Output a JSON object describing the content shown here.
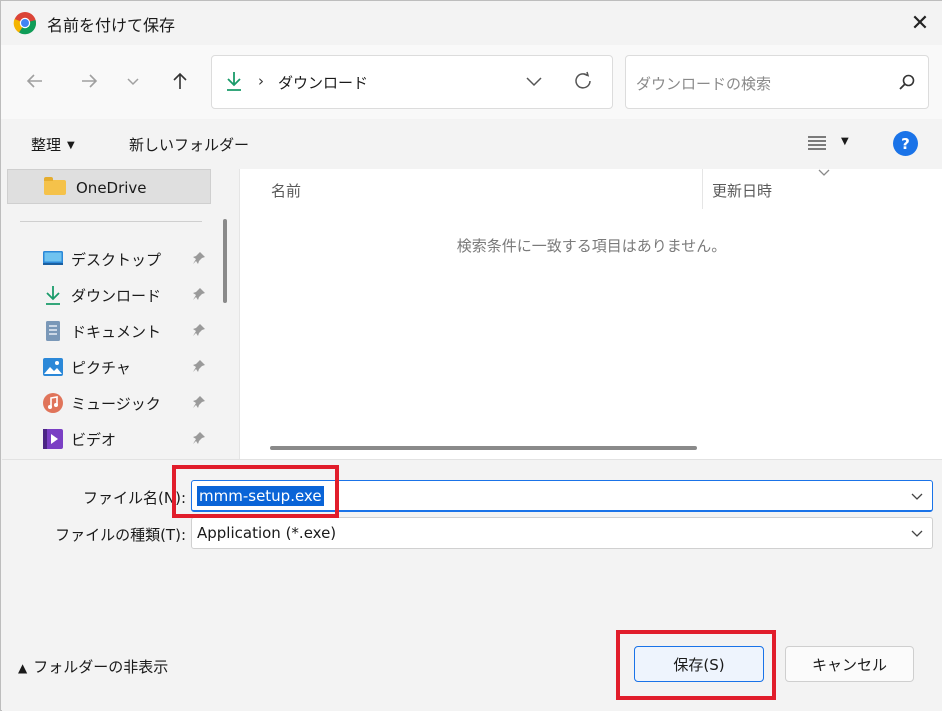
{
  "window": {
    "title": "名前を付けて保存",
    "close_glyph": "✕"
  },
  "nav": {
    "address_sep": "›",
    "address_path": "ダウンロード",
    "search_placeholder": "ダウンロードの検索"
  },
  "toolbar": {
    "organize_label": "整理",
    "new_folder_label": "新しいフォルダー"
  },
  "sidebar": {
    "onedrive_label": "OneDrive",
    "items": [
      {
        "label": "デスクトップ",
        "icon": "desktop-icon"
      },
      {
        "label": "ダウンロード",
        "icon": "download-icon"
      },
      {
        "label": "ドキュメント",
        "icon": "document-icon"
      },
      {
        "label": "ピクチャ",
        "icon": "pictures-icon"
      },
      {
        "label": "ミュージック",
        "icon": "music-icon"
      },
      {
        "label": "ビデオ",
        "icon": "video-icon"
      }
    ]
  },
  "filelist": {
    "columns": [
      "名前",
      "更新日時"
    ],
    "empty_message": "検索条件に一致する項目はありません。"
  },
  "form": {
    "filename_label": "ファイル名(N):",
    "filename_value": "mmm-setup.exe",
    "filetype_label": "ファイルの種類(T):",
    "filetype_value": "Application (*.exe)"
  },
  "footer": {
    "hide_folders_label": "フォルダーの非表示",
    "save_label": "保存(S)",
    "cancel_label": "キャンセル"
  },
  "colors": {
    "accent": "#1a73e8",
    "highlight_box": "#e11d2b",
    "selection": "#0a64d7"
  }
}
